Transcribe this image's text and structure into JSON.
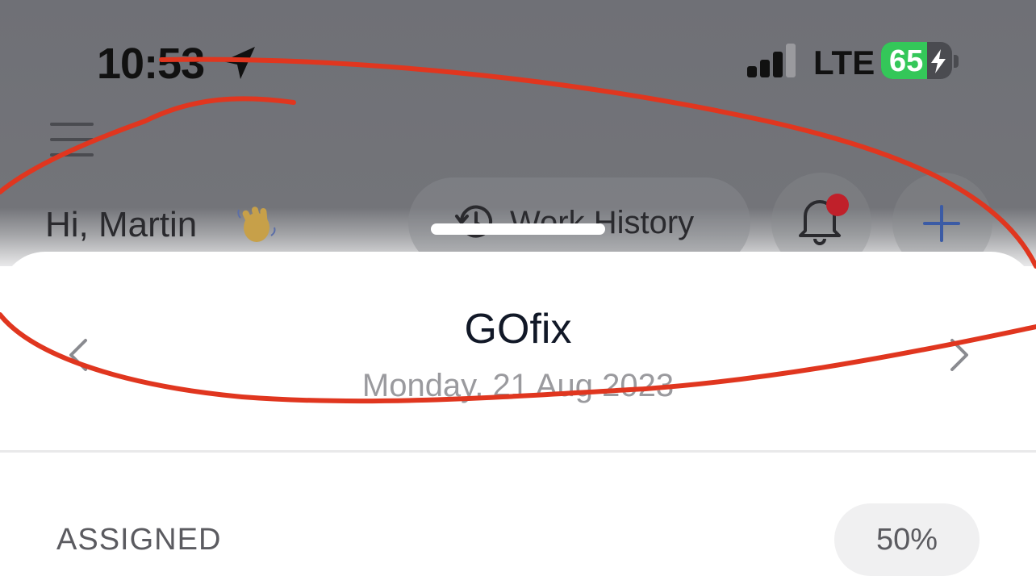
{
  "status_bar": {
    "time": "10:53",
    "network": "LTE",
    "battery": "65",
    "battery_level": 0.65,
    "icons": [
      "location-arrow-icon",
      "cellular-signal-icon",
      "battery-charging-icon"
    ]
  },
  "header": {
    "menu_icon": "hamburger-menu-icon",
    "greeting": "Hi, Martin",
    "greeting_emoji": "waving-hand-icon",
    "work_history_label": "Work History",
    "work_history_icon": "history-icon",
    "notifications_icon": "bell-icon",
    "notification_dot_color": "#c0202a",
    "add_icon": "plus-icon",
    "accent_color": "#3b5ba5"
  },
  "sheet": {
    "title": "GOfix",
    "date": "Monday, 21 Aug 2023",
    "prev_icon": "chevron-left-icon",
    "next_icon": "chevron-right-icon"
  },
  "assigned": {
    "label": "ASSIGNED",
    "percent": "50%"
  },
  "annotation": {
    "color": "#e0361f",
    "icon": "red-scribble-annotation"
  }
}
